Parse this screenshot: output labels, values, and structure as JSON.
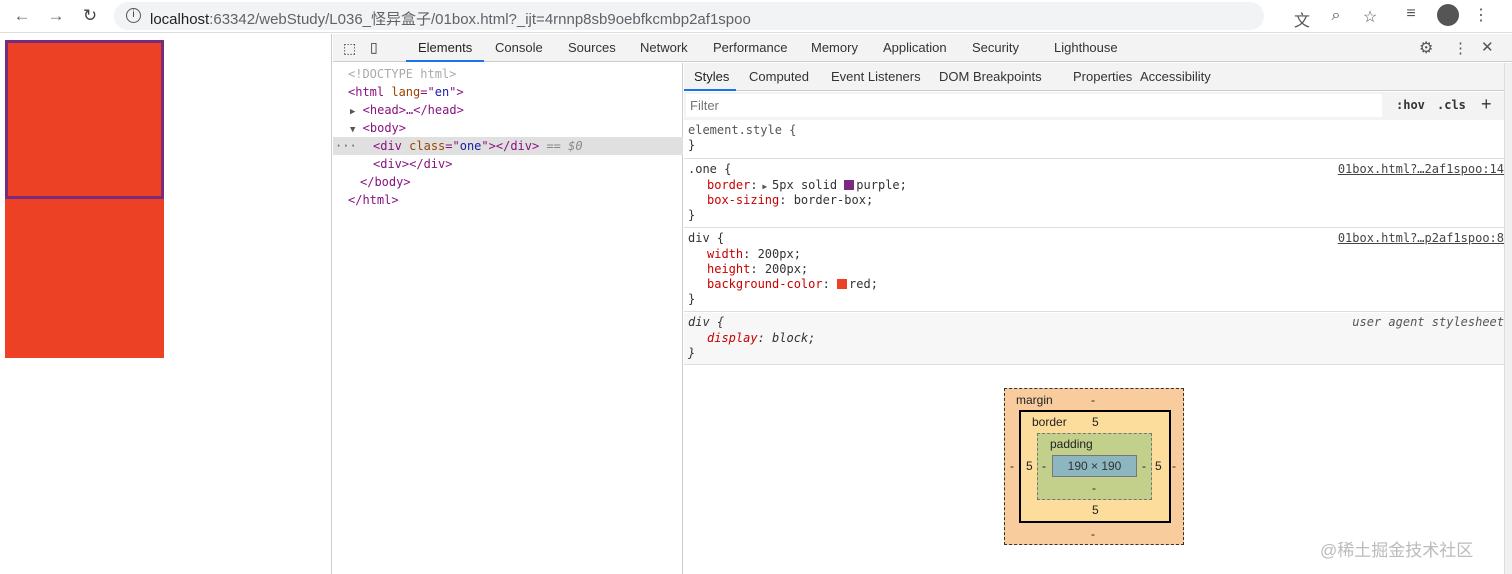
{
  "browser": {
    "url_host": "localhost",
    "url_rest": ":63342/webStudy/L036_怪异盒子/01box.html?_ijt=4rnnp8sb9oebfkcmbp2af1spoo"
  },
  "devtools": {
    "tabs": [
      "Elements",
      "Console",
      "Sources",
      "Network",
      "Performance",
      "Memory",
      "Application",
      "Security",
      "Lighthouse"
    ],
    "active_tab": "Elements"
  },
  "dom": {
    "doctype": "<!DOCTYPE html>",
    "html_open": "<html",
    "lang_attr": "lang",
    "lang_val": "en",
    "head": "<head>…</head>",
    "body_open": "<body>",
    "div_open": "<div",
    "class_attr": "class",
    "class_val": "one",
    "div_close": "></div>",
    "selected_marker": "== $0",
    "div2": "<div></div>",
    "body_close": "</body>",
    "html_close": "</html>",
    "ellipsis": "···"
  },
  "styles": {
    "subtabs": [
      "Styles",
      "Computed",
      "Event Listeners",
      "DOM Breakpoints",
      "Properties",
      "Accessibility"
    ],
    "filter_placeholder": "Filter",
    "hov": ":hov",
    "cls": ".cls",
    "plus": "+",
    "rules": [
      {
        "selector": "element.style {",
        "close": "}"
      },
      {
        "selector": ".one {",
        "source": "01box.html?…2af1spoo:14",
        "props": [
          {
            "name": "border",
            "value": "5px solid ",
            "color_name": "purple;",
            "swatch": "#7a2b7e"
          },
          {
            "name": "box-sizing",
            "value": "border-box;"
          }
        ],
        "close": "}"
      },
      {
        "selector": "div {",
        "source": "01box.html?…p2af1spoo:8",
        "props": [
          {
            "name": "width",
            "value": "200px;"
          },
          {
            "name": "height",
            "value": "200px;"
          },
          {
            "name": "background-color",
            "value": "",
            "color_name": "red;",
            "swatch": "#ec4125"
          }
        ],
        "close": "}"
      },
      {
        "selector": "div {",
        "source": "user agent stylesheet",
        "props": [
          {
            "name": "display",
            "value": "block;"
          }
        ],
        "close": "}"
      }
    ]
  },
  "box_model": {
    "margin_label": "margin",
    "margin_top": "-",
    "margin_bottom": "-",
    "margin_left": "-",
    "margin_right": "-",
    "border_label": "border",
    "border_top": "5",
    "border_bottom": "5",
    "border_left": "5",
    "border_right": "5",
    "padding_label": "padding",
    "padding_top": "",
    "padding_bottom": "-",
    "padding_left": "-",
    "padding_right": "-",
    "content": "190 × 190"
  },
  "watermark": "@稀土掘金技术社区"
}
